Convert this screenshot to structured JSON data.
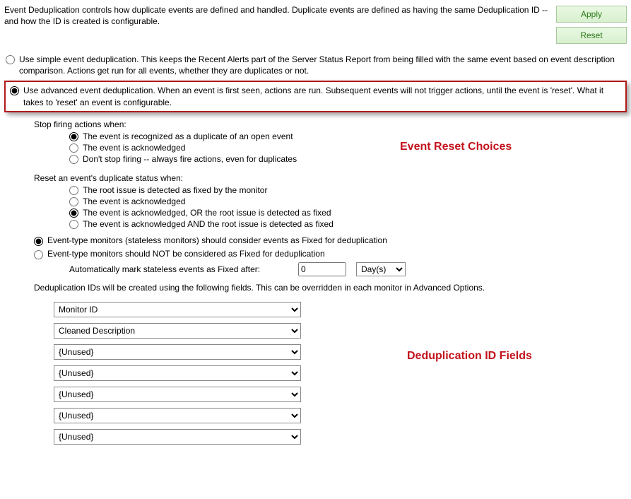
{
  "intro": "Event Deduplication controls how duplicate events are defined and handled.  Duplicate events are defined as having the same Deduplication ID -- and how the ID is created is configurable.",
  "buttons": {
    "apply": "Apply",
    "reset": "Reset"
  },
  "mode": {
    "simple": "Use simple event deduplication.  This keeps the Recent Alerts part of the Server Status Report from being filled with the same event based on event description comparison.  Actions get run for all events, whether they are duplicates or not.",
    "advanced": "Use advanced event deduplication.  When an event is first seen, actions are run.  Subsequent events will not trigger actions, until the event is 'reset'.  What it takes to 'reset' an event is configurable."
  },
  "stop": {
    "heading": "Stop firing actions when:",
    "o1": "The event is recognized as a duplicate of an open event",
    "o2": "The event is acknowledged",
    "o3": "Don't stop firing -- always fire actions, even for duplicates"
  },
  "callout_reset": "Event Reset Choices",
  "reset": {
    "heading": "Reset an event's duplicate status when:",
    "o1": "The root issue is detected as fixed by the monitor",
    "o2": "The event is acknowledged",
    "o3": "The event is acknowledged, OR the root issue is detected as fixed",
    "o4": "The event is acknowledged AND the root issue is detected as fixed"
  },
  "etype": {
    "o1": "Event-type monitors (stateless monitors) should consider events as Fixed for deduplication",
    "o2": "Event-type monitors should NOT be considered as Fixed for deduplication"
  },
  "stateless": {
    "label": "Automatically mark stateless events as Fixed after:",
    "value": "0",
    "unit": "Day(s)"
  },
  "dedup_para": "Deduplication IDs will be created using the following fields.  This can be overridden in each monitor in Advanced Options.",
  "callout_fields": "Deduplication ID Fields",
  "fields": {
    "f1": "Monitor ID",
    "f2": "Cleaned Description",
    "f3": "{Unused}",
    "f4": "{Unused}",
    "f5": "{Unused}",
    "f6": "{Unused}",
    "f7": "{Unused}"
  }
}
